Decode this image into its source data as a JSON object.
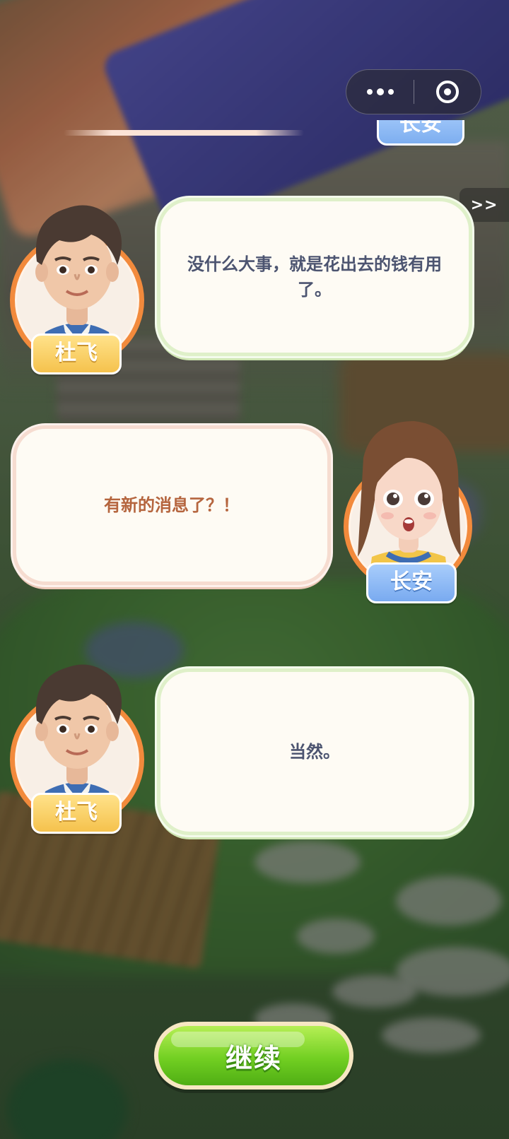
{
  "skip_label": ">>",
  "previous_entry": {
    "speaker": "长安"
  },
  "dialogue": [
    {
      "speaker": "杜飞",
      "text": "没什么大事，就是花出去的钱有用了。"
    },
    {
      "speaker": "长安",
      "text": "有新的消息了？！"
    },
    {
      "speaker": "杜飞",
      "text": "当然。"
    }
  ],
  "continue_label": "继续",
  "capsule": {
    "more_icon": "more-dots-icon",
    "close_icon": "close-target-icon"
  },
  "colors": {
    "name_tag_dufei": "#f5c24d",
    "name_tag_changan": "#79aaf0",
    "continue_button": "#72cf22",
    "avatar_ring": "#f28a3c"
  }
}
